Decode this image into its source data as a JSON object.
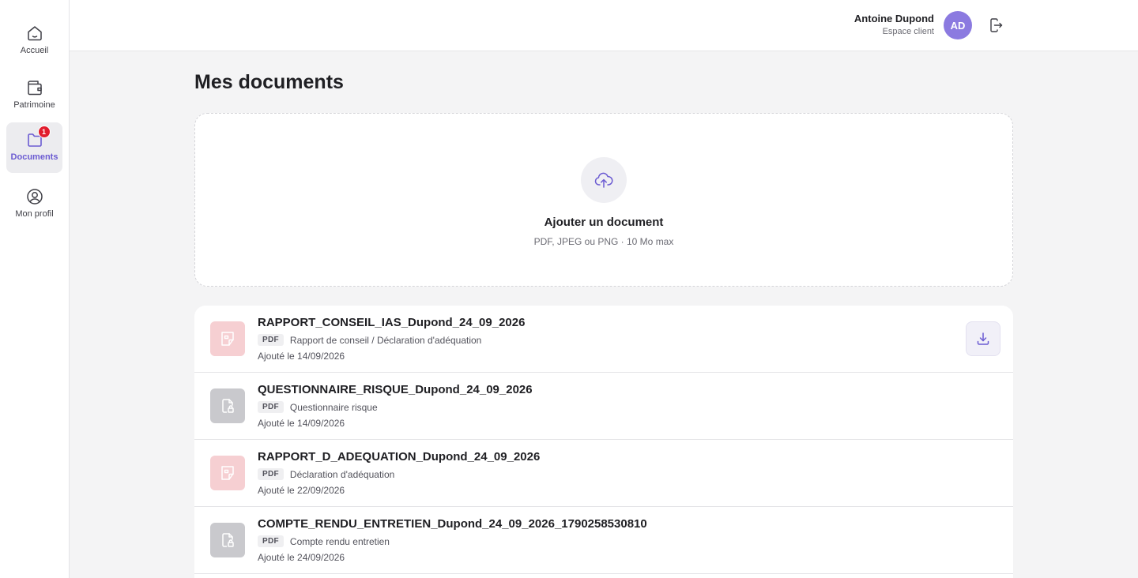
{
  "sidebar": {
    "items": [
      {
        "label": "Accueil",
        "icon": "home-icon"
      },
      {
        "label": "Patrimoine",
        "icon": "wallet-icon"
      },
      {
        "label": "Documents",
        "icon": "folder-icon",
        "badge": "1",
        "active": true
      },
      {
        "label": "Mon profil",
        "icon": "user-circle-icon"
      }
    ]
  },
  "header": {
    "user_name": "Antoine Dupond",
    "user_role": "Espace client",
    "avatar_initials": "AD",
    "logout_icon": "logout-icon"
  },
  "main": {
    "title": "Mes documents",
    "upload": {
      "title": "Ajouter un document",
      "subtitle": "PDF, JPEG ou PNG · 10 Mo max",
      "icon": "cloud-upload-icon"
    },
    "documents": [
      {
        "name": "RAPPORT_CONSEIL_IAS_Dupond_24_09_2026",
        "format": "PDF",
        "type": "Rapport de conseil / Déclaration d'adéquation",
        "date": "Ajouté le 14/09/2026",
        "style": "pink"
      },
      {
        "name": "QUESTIONNAIRE_RISQUE_Dupond_24_09_2026",
        "format": "PDF",
        "type": "Questionnaire risque",
        "date": "Ajouté le 14/09/2026",
        "style": "gray"
      },
      {
        "name": "RAPPORT_D_ADEQUATION_Dupond_24_09_2026",
        "format": "PDF",
        "type": "Déclaration d'adéquation",
        "date": "Ajouté le 22/09/2026",
        "style": "pink"
      },
      {
        "name": "COMPTE_RENDU_ENTRETIEN_Dupond_24_09_2026_1790258530810",
        "format": "PDF",
        "type": "Compte rendu entretien",
        "date": "Ajouté le 24/09/2026",
        "style": "gray"
      }
    ]
  },
  "colors": {
    "accent": "#6b5bd2",
    "avatar": "#8b7ae0",
    "badge": "#e11d2e",
    "pdf_pink": "#f6cfd2",
    "file_gray": "#c9c9cd"
  }
}
